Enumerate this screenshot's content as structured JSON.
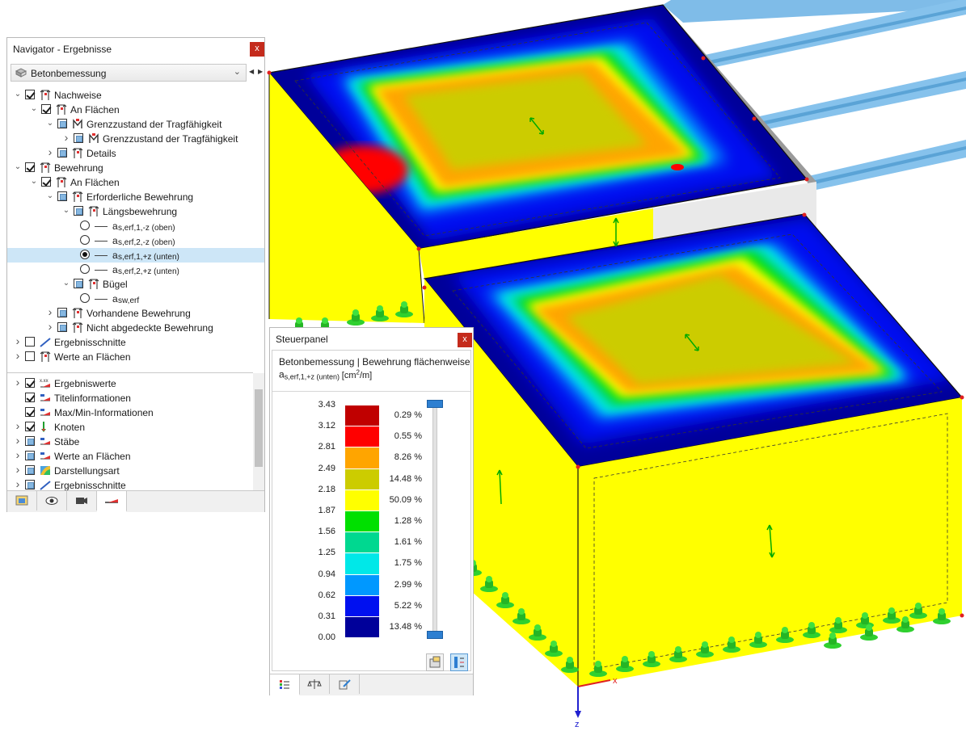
{
  "navigator": {
    "title": "Navigator - Ergebnisse",
    "close_label": "x",
    "combo_value": "Betonbemessung",
    "tree_top": [
      {
        "label": "Nachweise",
        "level": 0,
        "check": "checked",
        "expand": "down",
        "icon": "result-icon"
      },
      {
        "label": "An Flächen",
        "level": 1,
        "check": "checked",
        "expand": "down",
        "icon": "result-icon"
      },
      {
        "label": "Grenzzustand der Tragfähigkeit",
        "level": 2,
        "check": "empty",
        "expand": "down",
        "icon": "uls-icon"
      },
      {
        "label": "Grenzzustand der Tragfähigkeit",
        "level": 3,
        "check": "empty",
        "expand": "right",
        "icon": "uls-icon"
      },
      {
        "label": "Details",
        "level": 2,
        "check": "empty",
        "expand": "right",
        "icon": "result-icon"
      },
      {
        "label": "Bewehrung",
        "level": 0,
        "check": "checked",
        "expand": "down",
        "icon": "result-icon"
      },
      {
        "label": "An Flächen",
        "level": 1,
        "check": "checked",
        "expand": "down",
        "icon": "result-icon"
      },
      {
        "label": "Erforderliche Bewehrung",
        "level": 2,
        "check": "empty",
        "expand": "down",
        "icon": "result-icon"
      },
      {
        "label": "Längsbewehrung",
        "level": 3,
        "check": "empty",
        "expand": "down",
        "icon": "result-icon"
      },
      {
        "label": "a",
        "sub": "s,erf,1,-z (oben)",
        "level": 4,
        "radio": "off"
      },
      {
        "label": "a",
        "sub": "s,erf,2,-z (oben)",
        "level": 4,
        "radio": "off"
      },
      {
        "label": "a",
        "sub": "s,erf,1,+z (unten)",
        "level": 4,
        "radio": "on",
        "selected": true
      },
      {
        "label": "a",
        "sub": "s,erf,2,+z (unten)",
        "level": 4,
        "radio": "off"
      },
      {
        "label": "Bügel",
        "level": 3,
        "check": "empty",
        "expand": "down",
        "icon": "result-icon"
      },
      {
        "label": "a",
        "sub": "sw,erf",
        "level": 4,
        "radio": "off"
      },
      {
        "label": "Vorhandene Bewehrung",
        "level": 2,
        "check": "empty",
        "expand": "right",
        "icon": "result-icon"
      },
      {
        "label": "Nicht abgedeckte Bewehrung",
        "level": 2,
        "check": "empty",
        "expand": "right",
        "icon": "result-icon"
      },
      {
        "label": "Ergebnisschnitte",
        "level": 0,
        "check": "unchecked",
        "expand": "right",
        "icon": "section-icon"
      },
      {
        "label": "Werte an Flächen",
        "level": 0,
        "check": "unchecked",
        "expand": "right",
        "icon": "result-icon"
      }
    ],
    "tree_bottom": [
      {
        "label": "Ergebniswerte",
        "check": "checked",
        "expand": "right",
        "icon": "values-icon"
      },
      {
        "label": "Titelinformationen",
        "check": "checked",
        "expand": "",
        "icon": "title-info-icon"
      },
      {
        "label": "Max/Min-Informationen",
        "check": "checked",
        "expand": "",
        "icon": "maxmin-icon"
      },
      {
        "label": "Knoten",
        "check": "checked",
        "expand": "right",
        "icon": "node-icon"
      },
      {
        "label": "Stäbe",
        "check": "empty",
        "expand": "right",
        "icon": "member-icon"
      },
      {
        "label": "Werte an Flächen",
        "check": "empty",
        "expand": "right",
        "icon": "surface-values-icon"
      },
      {
        "label": "Darstellungsart",
        "check": "empty",
        "expand": "right",
        "icon": "display-type-icon"
      },
      {
        "label": "Ergebnisschnitte",
        "check": "empty",
        "expand": "right",
        "icon": "section-icon"
      }
    ],
    "tabs": [
      "data-icon",
      "view-icon",
      "camera-icon",
      "results-icon"
    ]
  },
  "panel": {
    "title": "Steuerpanel",
    "close_label": "x",
    "header": "Betonbemessung | Bewehrung flächenweise",
    "sub_main": "a",
    "sub_index": "s,erf,1,+z (unten)",
    "unit_pre": "[cm",
    "unit_sup": "2",
    "unit_post": "/m]",
    "legend_values": [
      "3.43",
      "3.12",
      "2.81",
      "2.49",
      "2.18",
      "1.87",
      "1.56",
      "1.25",
      "0.94",
      "0.62",
      "0.31",
      "0.00"
    ],
    "legend_colors": [
      "#c00000",
      "#ff0000",
      "#ffa500",
      "#cccc00",
      "#ffff00",
      "#00e000",
      "#00d890",
      "#00e8e8",
      "#0098ff",
      "#0010f0",
      "#00009a"
    ],
    "legend_percents": [
      "0.29 %",
      "0.55 %",
      "8.26 %",
      "14.48 %",
      "50.09 %",
      "1.28 %",
      "1.61 %",
      "1.75 %",
      "2.99 %",
      "5.22 %",
      "13.48 %"
    ],
    "tabs": [
      "color-scale-icon",
      "balance-icon",
      "edit-icon"
    ]
  },
  "axis": {
    "x": "x",
    "z": "z"
  },
  "colors": {
    "close": "#c42b1c",
    "selection": "#cde6f7",
    "accent": "#2d7fd1"
  }
}
